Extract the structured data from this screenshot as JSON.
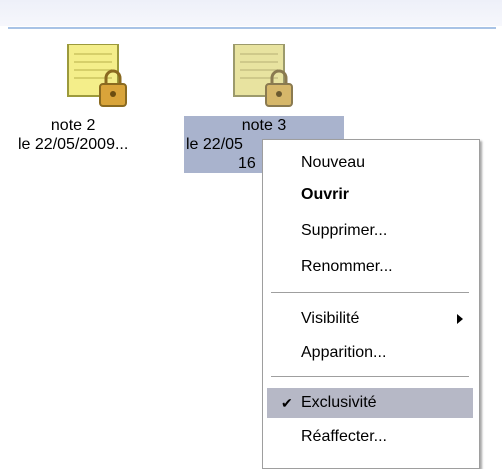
{
  "icons": [
    {
      "name": "note 2",
      "line2": "le 22/05/2009...",
      "selected": false
    },
    {
      "name": "note 3",
      "line2": "le 22/05",
      "line3": "16",
      "selected": true
    }
  ],
  "context_menu": {
    "items": [
      {
        "label": "Nouveau"
      },
      {
        "label": "Ouvrir",
        "default": true
      },
      {
        "label": "Supprimer..."
      },
      {
        "label": "Renommer..."
      },
      {
        "label": "Visibilité",
        "submenu": true
      },
      {
        "label": "Apparition..."
      },
      {
        "label": "Exclusivité",
        "checked": true,
        "highlighted": true
      },
      {
        "label": "Réaffecter..."
      }
    ]
  },
  "icon_names": {
    "note": "locked-note-icon",
    "check": "checkmark-icon",
    "submenu": "submenu-arrow-icon"
  },
  "colors": {
    "selection": "#a9b3cd",
    "menu_highlight": "#b6b8c6",
    "note_yellow": "#f4ee8a",
    "lock_gold": "#d9a43a"
  }
}
